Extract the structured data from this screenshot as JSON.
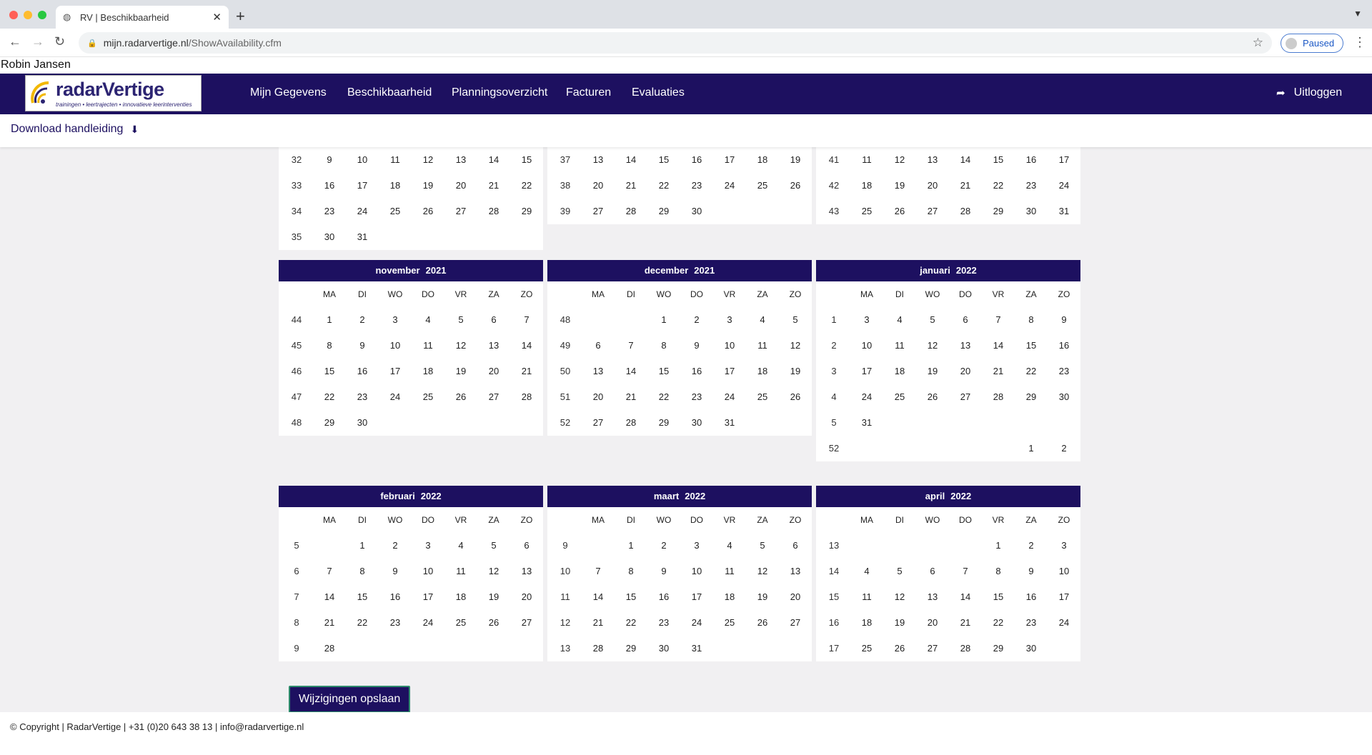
{
  "browser": {
    "tab_title": "RV | Beschikbaarheid",
    "url_domain": "mijn.radarvertige.nl",
    "url_path": "/ShowAvailability.cfm",
    "profile_status": "Paused"
  },
  "user": {
    "name": "Robin Jansen"
  },
  "brand": {
    "name": "radarVertige",
    "tagline": "trainingen • leertrajecten • innovatieve leerinterventies"
  },
  "nav": {
    "items": [
      {
        "label": "Mijn Gegevens"
      },
      {
        "label": "Beschikbaarheid"
      },
      {
        "label": "Planningsoverzicht"
      },
      {
        "label": "Facturen"
      },
      {
        "label": "Evaluaties"
      }
    ],
    "logout": "Uitloggen"
  },
  "subbar": {
    "download": "Download handleiding"
  },
  "weekday_headers": [
    "MA",
    "DI",
    "WO",
    "DO",
    "VR",
    "ZA",
    "ZO"
  ],
  "calendars": [
    {
      "month": "",
      "year": "",
      "rows": [
        [
          "32",
          "9",
          "10",
          "11",
          "12",
          "13",
          "14",
          "15"
        ],
        [
          "33",
          "16",
          "17",
          "18",
          "19",
          "20",
          "21",
          "22"
        ],
        [
          "34",
          "23",
          "24",
          "25",
          "26",
          "27",
          "28",
          "29"
        ],
        [
          "35",
          "30",
          "31",
          "",
          "",
          "",
          "",
          ""
        ]
      ]
    },
    {
      "month": "",
      "year": "",
      "rows": [
        [
          "37",
          "13",
          "14",
          "15",
          "16",
          "17",
          "18",
          "19"
        ],
        [
          "38",
          "20",
          "21",
          "22",
          "23",
          "24",
          "25",
          "26"
        ],
        [
          "39",
          "27",
          "28",
          "29",
          "30",
          "",
          "",
          ""
        ]
      ]
    },
    {
      "month": "",
      "year": "",
      "rows": [
        [
          "41",
          "11",
          "12",
          "13",
          "14",
          "15",
          "16",
          "17"
        ],
        [
          "42",
          "18",
          "19",
          "20",
          "21",
          "22",
          "23",
          "24"
        ],
        [
          "43",
          "25",
          "26",
          "27",
          "28",
          "29",
          "30",
          "31"
        ]
      ]
    },
    {
      "month": "november",
      "year": "2021",
      "rows": [
        [
          "44",
          "1",
          "2",
          "3",
          "4",
          "5",
          "6",
          "7"
        ],
        [
          "45",
          "8",
          "9",
          "10",
          "11",
          "12",
          "13",
          "14"
        ],
        [
          "46",
          "15",
          "16",
          "17",
          "18",
          "19",
          "20",
          "21"
        ],
        [
          "47",
          "22",
          "23",
          "24",
          "25",
          "26",
          "27",
          "28"
        ],
        [
          "48",
          "29",
          "30",
          "",
          "",
          "",
          "",
          ""
        ]
      ]
    },
    {
      "month": "december",
      "year": "2021",
      "rows": [
        [
          "48",
          "",
          "",
          "1",
          "2",
          "3",
          "4",
          "5"
        ],
        [
          "49",
          "6",
          "7",
          "8",
          "9",
          "10",
          "11",
          "12"
        ],
        [
          "50",
          "13",
          "14",
          "15",
          "16",
          "17",
          "18",
          "19"
        ],
        [
          "51",
          "20",
          "21",
          "22",
          "23",
          "24",
          "25",
          "26"
        ],
        [
          "52",
          "27",
          "28",
          "29",
          "30",
          "31",
          "",
          ""
        ]
      ]
    },
    {
      "month": "januari",
      "year": "2022",
      "rows": [
        [
          "1",
          "3",
          "4",
          "5",
          "6",
          "7",
          "8",
          "9"
        ],
        [
          "2",
          "10",
          "11",
          "12",
          "13",
          "14",
          "15",
          "16"
        ],
        [
          "3",
          "17",
          "18",
          "19",
          "20",
          "21",
          "22",
          "23"
        ],
        [
          "4",
          "24",
          "25",
          "26",
          "27",
          "28",
          "29",
          "30"
        ],
        [
          "5",
          "31",
          "",
          "",
          "",
          "",
          "",
          ""
        ],
        [
          "52",
          "",
          "",
          "",
          "",
          "",
          "1",
          "2"
        ]
      ]
    },
    {
      "month": "februari",
      "year": "2022",
      "rows": [
        [
          "5",
          "",
          "1",
          "2",
          "3",
          "4",
          "5",
          "6"
        ],
        [
          "6",
          "7",
          "8",
          "9",
          "10",
          "11",
          "12",
          "13"
        ],
        [
          "7",
          "14",
          "15",
          "16",
          "17",
          "18",
          "19",
          "20"
        ],
        [
          "8",
          "21",
          "22",
          "23",
          "24",
          "25",
          "26",
          "27"
        ],
        [
          "9",
          "28",
          "",
          "",
          "",
          "",
          "",
          ""
        ]
      ]
    },
    {
      "month": "maart",
      "year": "2022",
      "rows": [
        [
          "9",
          "",
          "1",
          "2",
          "3",
          "4",
          "5",
          "6"
        ],
        [
          "10",
          "7",
          "8",
          "9",
          "10",
          "11",
          "12",
          "13"
        ],
        [
          "11",
          "14",
          "15",
          "16",
          "17",
          "18",
          "19",
          "20"
        ],
        [
          "12",
          "21",
          "22",
          "23",
          "24",
          "25",
          "26",
          "27"
        ],
        [
          "13",
          "28",
          "29",
          "30",
          "31",
          "",
          "",
          ""
        ]
      ]
    },
    {
      "month": "april",
      "year": "2022",
      "rows": [
        [
          "13",
          "",
          "",
          "",
          "",
          "1",
          "2",
          "3"
        ],
        [
          "14",
          "4",
          "5",
          "6",
          "7",
          "8",
          "9",
          "10"
        ],
        [
          "15",
          "11",
          "12",
          "13",
          "14",
          "15",
          "16",
          "17"
        ],
        [
          "16",
          "18",
          "19",
          "20",
          "21",
          "22",
          "23",
          "24"
        ],
        [
          "17",
          "25",
          "26",
          "27",
          "28",
          "29",
          "30",
          ""
        ]
      ]
    }
  ],
  "save_button": "Wijzigingen opslaan",
  "footer": "© Copyright | RadarVertige | +31 (0)20 643 38 13 | info@radarvertige.nl",
  "colors": {
    "nav_bg": "#1d1060",
    "page_bg": "#f1f0f2",
    "button_border": "#2e8b6c"
  }
}
